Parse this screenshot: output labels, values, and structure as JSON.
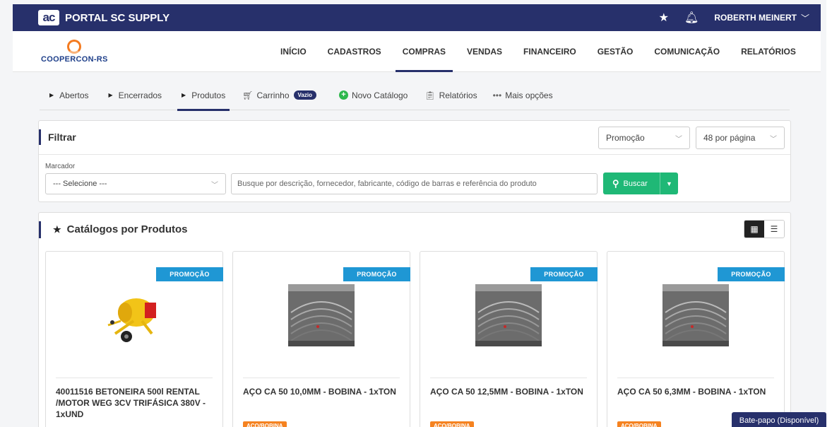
{
  "topbar": {
    "logo_text": "ac",
    "title": "PORTAL SC SUPPLY",
    "user": "ROBERTH MEINERT",
    "star_icon": "star-icon",
    "bell_icon": "bell-icon"
  },
  "brand": {
    "name": "COOPERCON-RS"
  },
  "menu": [
    {
      "label": "INÍCIO"
    },
    {
      "label": "CADASTROS"
    },
    {
      "label": "COMPRAS",
      "active": true
    },
    {
      "label": "VENDAS"
    },
    {
      "label": "FINANCEIRO"
    },
    {
      "label": "GESTÃO"
    },
    {
      "label": "COMUNICAÇÃO"
    },
    {
      "label": "RELATÓRIOS"
    }
  ],
  "subnav": {
    "abertos": "Abertos",
    "encerrados": "Encerrados",
    "produtos": "Produtos",
    "carrinho": "Carrinho",
    "carrinho_badge": "Vazio",
    "novo_catalogo": "Novo Catálogo",
    "relatorios": "Relatórios",
    "mais_opcoes": "Mais opções"
  },
  "filter": {
    "title": "Filtrar",
    "sort_value": "Promoção",
    "per_page_value": "48 por página",
    "marcador_label": "Marcador",
    "marcador_value": "--- Selecione ---",
    "search_placeholder": "Busque por descrição, fornecedor, fabricante, código de barras e referência do produto",
    "search_button": "Buscar"
  },
  "catalog": {
    "title": "Catálogos por Produtos",
    "cards": [
      {
        "badge": "PROMOÇÃO",
        "title": "40011516 BETONEIRA 500l RENTAL /MOTOR WEG 3CV TRIFÁSICA 380V - 1xUND",
        "tag": "",
        "image": "concrete-mixer"
      },
      {
        "badge": "PROMOÇÃO",
        "title": "AÇO CA 50 10,0MM - BOBINA - 1xTON",
        "tag": "AÇO/BOBINA",
        "image": "steel-coil"
      },
      {
        "badge": "PROMOÇÃO",
        "title": "AÇO CA 50 12,5MM - BOBINA - 1xTON",
        "tag": "AÇO/BOBINA",
        "image": "steel-coil"
      },
      {
        "badge": "PROMOÇÃO",
        "title": "AÇO CA 50 6,3MM - BOBINA - 1xTON",
        "tag": "AÇO/BOBINA",
        "image": "steel-coil"
      }
    ]
  },
  "chat": {
    "label": "Bate-papo (Disponível)"
  },
  "colors": {
    "navy": "#27306b",
    "green": "#1fb876",
    "promo_blue": "#1f97d4",
    "tag_orange": "#f58220"
  }
}
